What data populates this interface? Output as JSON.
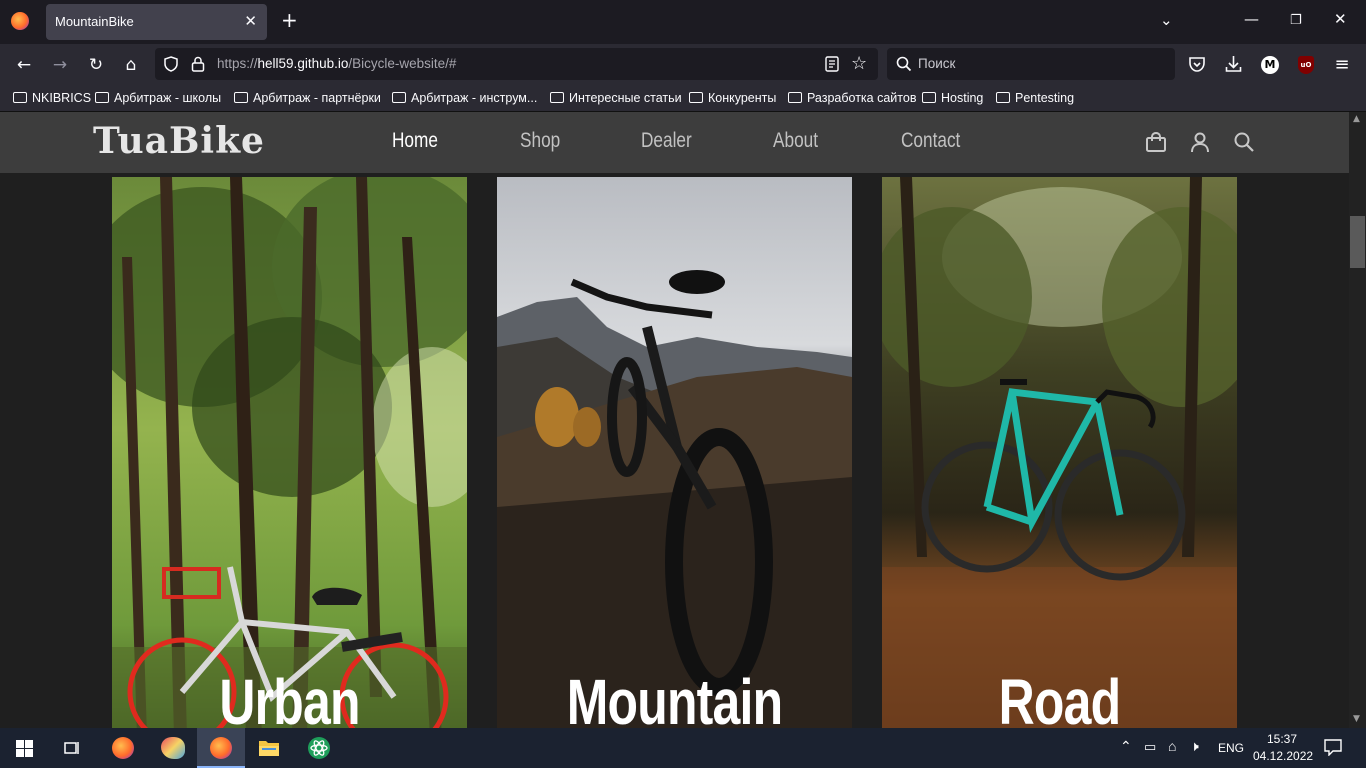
{
  "browser": {
    "tab_title": "MountainBike",
    "url_host": "hell59.github.io",
    "url_prefix": "https://",
    "url_path": "/Bicycle-website/#",
    "search_placeholder": "Поиск",
    "bookmarks": [
      "NKIBRICS",
      "Арбитраж - школы",
      "Арбитраж - партнёрки",
      "Арбитраж - инструм...",
      "Интересные статьи",
      "Конкуренты",
      "Разработка сайтов",
      "Hosting",
      "Pentesting"
    ],
    "profile_initial": "M",
    "ublock_label": "uO"
  },
  "site": {
    "logo": "TuaBike",
    "nav": [
      "Home",
      "Shop",
      "Dealer",
      "About",
      "Contact"
    ],
    "active_nav": "Home",
    "cards": [
      "Urban",
      "Mountain",
      "Road"
    ]
  },
  "taskbar": {
    "language": "ENG",
    "time": "15:37",
    "date": "04.12.2022"
  },
  "colors": {
    "header_bg": "#3d3d3d",
    "page_bg": "#1f1f1f",
    "road_bike": "#1fb8a8",
    "urban_bike_accent": "#d62b20"
  }
}
